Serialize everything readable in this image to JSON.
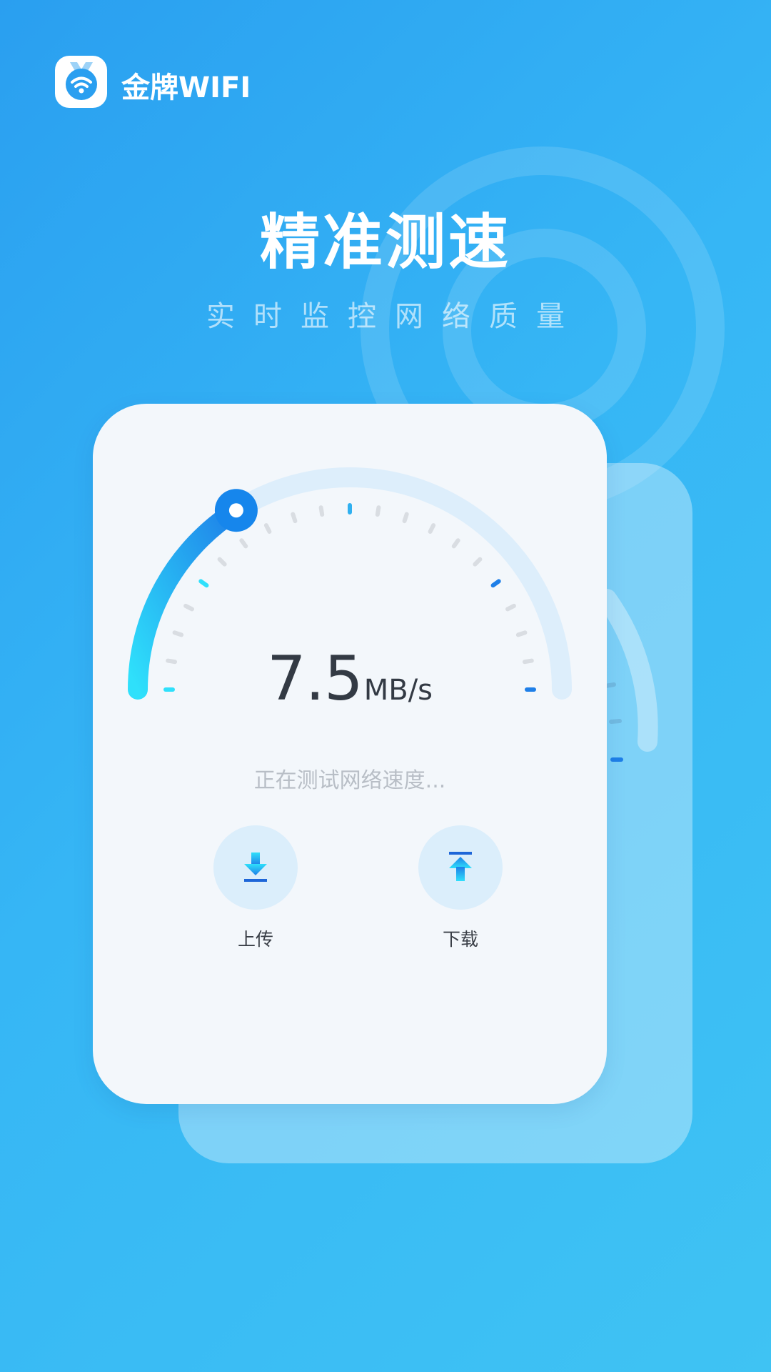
{
  "app": {
    "name": "金牌WIFI",
    "logo_icon": "wifi-medal-icon"
  },
  "hero": {
    "title": "精准测速",
    "subtitle": "实时监控网络质量"
  },
  "speedometer": {
    "speed_value": "7.5",
    "speed_unit": "MB/s",
    "status_text": "正在测试网络速度...",
    "progress_fraction": 0.32
  },
  "actions": [
    {
      "label": "上传",
      "icon": "download-arrow-icon"
    },
    {
      "label": "下载",
      "icon": "upload-arrow-icon"
    }
  ],
  "colors": {
    "background_start": "#2a9ff0",
    "background_end": "#3fc3f3",
    "gauge_gradient_start": "#2fe0fb",
    "gauge_gradient_end": "#1e7fe8",
    "gauge_track": "#ddeefb",
    "knob": "#1686ec",
    "card": "#f3f7fb",
    "action_circle": "#dbeefb"
  }
}
